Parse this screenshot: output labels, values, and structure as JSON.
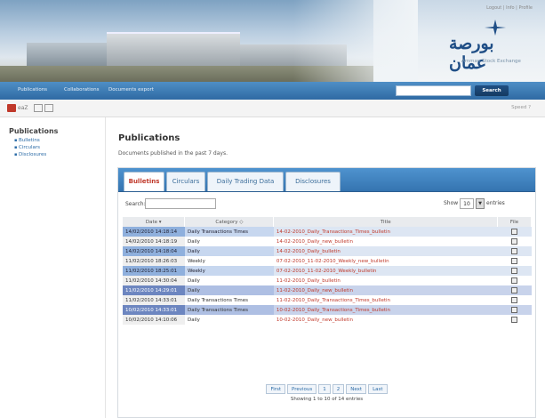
{
  "header": {
    "top_links": "Logout | Info | Profile",
    "logo_arabic": "بورصة عمان",
    "logo_english": "Amman Stock Exchange"
  },
  "nav": {
    "items": [
      "Publications",
      "Collaborations",
      "Documents export"
    ],
    "search_button": "Search"
  },
  "toolbar": {
    "export_label": "eaZ",
    "speed_label": "Speed ?"
  },
  "sidebar": {
    "title": "Publications",
    "links": [
      "Bulletins",
      "Circulars",
      "Disclosures"
    ]
  },
  "main": {
    "title": "Publications",
    "subtitle": "Documents published in the past 7 days.",
    "tabs": [
      "Bulletins",
      "Circulars",
      "Daily Trading Data",
      "Disclosures"
    ],
    "active_tab": 0,
    "search_label": "Search:",
    "show_label": "Show",
    "entries_count": "10",
    "entries_label": "entries",
    "columns": [
      "Date",
      "Category",
      "Title",
      "File"
    ],
    "rows": [
      {
        "date": "14/02/2010 14:18:14",
        "category": "Daily Transactions Times",
        "title": "14-02-2010_Daily_Transactions_Times_bulletin",
        "style": "hl"
      },
      {
        "date": "14/02/2010 14:18:19",
        "category": "Daily",
        "title": "14-02-2010_Daily_new_bulletin",
        "style": "pl"
      },
      {
        "date": "14/02/2010 14:18:04",
        "category": "Daily",
        "title": "14-02-2010_Daily_bulletin",
        "style": "hl"
      },
      {
        "date": "11/02/2010 18:26:03",
        "category": "Weekly",
        "title": "07-02-2010_11-02-2010_Weekly_new_bulletin",
        "style": "pl"
      },
      {
        "date": "11/02/2010 18:25:01",
        "category": "Weekly",
        "title": "07-02-2010_11-02-2010_Weekly_bulletin",
        "style": "hl"
      },
      {
        "date": "11/02/2010 14:30:04",
        "category": "Daily",
        "title": "11-02-2010_Daily_bulletin",
        "style": "pl"
      },
      {
        "date": "11/02/2010 14:29:01",
        "category": "Daily",
        "title": "11-02-2010_Daily_new_bulletin",
        "style": "dk"
      },
      {
        "date": "11/02/2010 14:33:01",
        "category": "Daily Transactions Times",
        "title": "11-02-2010_Daily_Transactions_Times_bulletin",
        "style": "pl"
      },
      {
        "date": "10/02/2010 14:33:01",
        "category": "Daily Transactions Times",
        "title": "10-02-2010_Daily_Transactions_Times_bulletin",
        "style": "dk"
      },
      {
        "date": "10/02/2010 14:10:06",
        "category": "Daily",
        "title": "10-02-2010_Daily_new_bulletin",
        "style": "pl"
      }
    ],
    "pager": [
      "First",
      "Previous",
      "1",
      "2",
      "Next",
      "Last"
    ],
    "info": "Showing 1 to 10 of 14 entries"
  }
}
